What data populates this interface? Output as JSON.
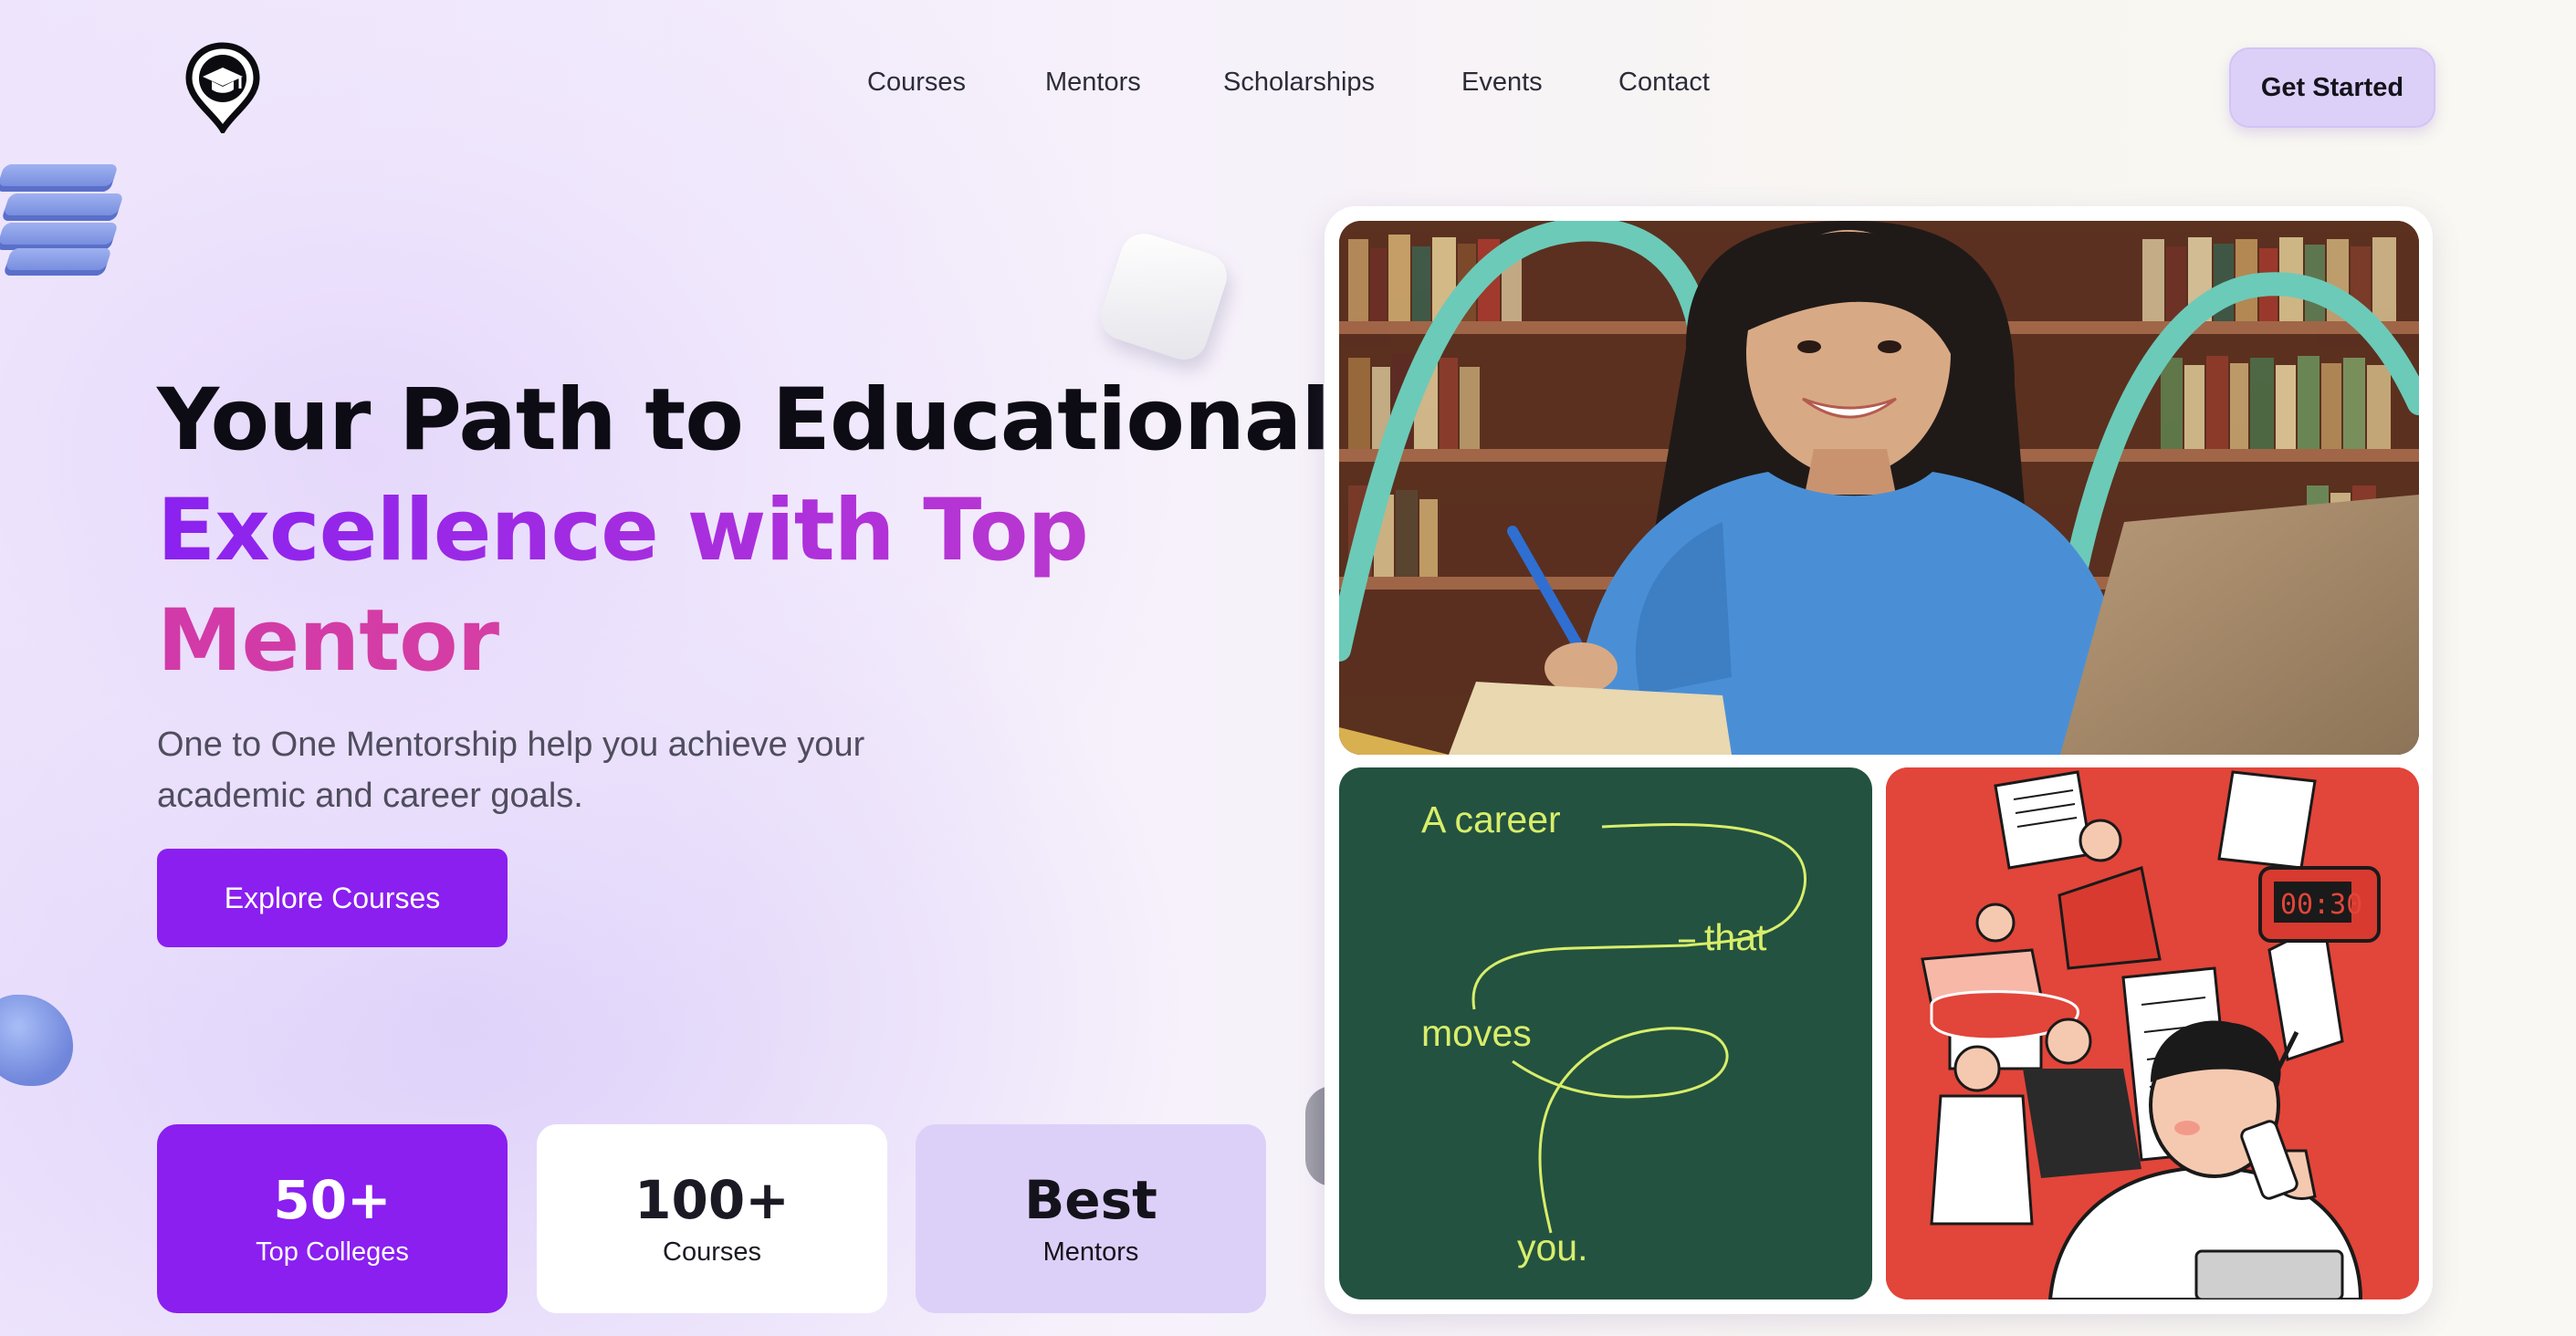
{
  "nav": {
    "items": [
      "Courses",
      "Mentors",
      "Scholarships",
      "Events",
      "Contact"
    ],
    "cta_label": "Get Started"
  },
  "hero": {
    "title_line1": "Your Path to Educational",
    "title_line2": "Excellence with Top",
    "title_line3": "Mentor",
    "subtitle_line1": "One to One Mentorship help you achieve your",
    "subtitle_line2": "academic and career goals.",
    "cta_label": "Explore Courses"
  },
  "stats": [
    {
      "value": "50+",
      "label": "Top Colleges"
    },
    {
      "value": "100+",
      "label": "Courses"
    },
    {
      "value": "Best",
      "label": "Mentors"
    }
  ],
  "gallery": {
    "career_words": [
      "A career",
      "that",
      "moves",
      "you."
    ]
  },
  "colors": {
    "primary": "#8a1ff0",
    "soft_lavender": "#ddd0f8",
    "career_tile": "#235240",
    "career_text": "#d8ee6a",
    "illustration_red": "#e2453a"
  },
  "icons": {
    "logo": "graduation-cap-pin-icon"
  }
}
